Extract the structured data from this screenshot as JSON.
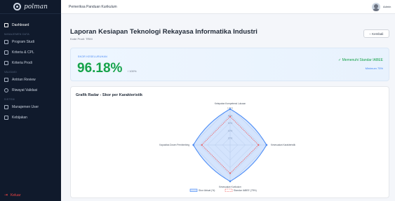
{
  "sidebar": {
    "brand": "polman",
    "items_main": [
      {
        "label": "Dashboard",
        "icon": "home-icon",
        "active": true
      }
    ],
    "section_master": "MANAJEMEN DATA",
    "items_master": [
      {
        "label": "Program Studi",
        "icon": "building-icon"
      },
      {
        "label": "Kriteria & CPL",
        "icon": "document-icon"
      },
      {
        "label": "Kriteria Prodi",
        "icon": "list-icon"
      }
    ],
    "section_validasi": "VALIDASI",
    "items_validasi": [
      {
        "label": "Antrian Review",
        "icon": "inbox-icon"
      },
      {
        "label": "Riwayat Validasi",
        "icon": "clock-icon"
      }
    ],
    "section_sistem": "SISTEM",
    "items_sistem": [
      {
        "label": "Manajemen User",
        "icon": "users-icon"
      },
      {
        "label": "Kebijakan",
        "icon": "file-icon"
      }
    ],
    "logout": "Keluar"
  },
  "topbar": {
    "title": "Pemeriksa Panduan Kurikulum",
    "user": "Admin"
  },
  "page": {
    "title": "Laporan Kesiapan Teknologi Rekayasa Informatika Industri",
    "subtitle": "Kode Prodi: TRIM",
    "back_label": "Kembali"
  },
  "score": {
    "label": "SKOR KESELURUHAN",
    "value": "96.18%",
    "max": "/ 100%",
    "badge": "✓ Memenuhi Standar IABEE",
    "minimum": "Minimum 75%"
  },
  "colors": {
    "score_green": "#16a34a",
    "accent_blue": "#3b82f6",
    "standard_red": "#ef4444"
  },
  "chart_data": {
    "type": "radar",
    "title": "Grafik Radar - Skor per Karakteristik",
    "axes": [
      "Ketepatan Kompetensi Lulusan",
      "Kesesuaian Kurikulum",
      "Kapasitas Dosen Pembimbing",
      "Kesesuaian Karakteristik"
    ],
    "rings": [
      "20%",
      "40%",
      "60%",
      "80%",
      "100%"
    ],
    "range": [
      0,
      100
    ],
    "series": [
      {
        "name": "Skor Aktual (%)",
        "values": [
          95,
          96,
          97,
          96
        ],
        "color": "#3b82f6"
      },
      {
        "name": "Standar IABEE (75%)",
        "values": [
          75,
          75,
          75,
          75
        ],
        "color": "#ef4444"
      }
    ],
    "legend_position": "bottom"
  }
}
